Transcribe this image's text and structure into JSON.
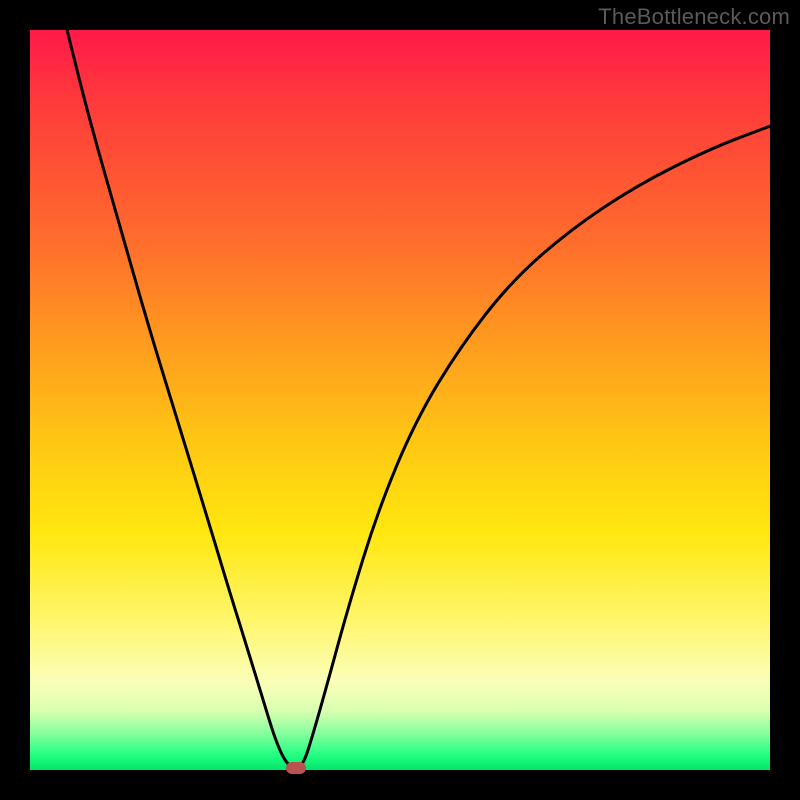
{
  "watermark": "TheBottleneck.com",
  "colors": {
    "frame": "#000000",
    "gradient_top": "#ff1a49",
    "gradient_mid": "#ffe70f",
    "gradient_bottom": "#00e56a",
    "curve": "#000000",
    "marker": "#b9524f"
  },
  "chart_data": {
    "type": "line",
    "title": "",
    "xlabel": "",
    "ylabel": "",
    "xlim": [
      0,
      100
    ],
    "ylim": [
      0,
      100
    ],
    "grid": false,
    "series": [
      {
        "name": "bottleneck-curve",
        "x": [
          5,
          8,
          12,
          16,
          20,
          24,
          27,
          29.5,
          31.5,
          33,
          34.5,
          36,
          37,
          38,
          40,
          43,
          47,
          52,
          58,
          65,
          73,
          82,
          92,
          100
        ],
        "y": [
          100,
          88,
          74,
          60,
          47,
          34,
          24,
          16,
          9.5,
          4.5,
          1,
          0,
          1,
          4,
          11,
          22,
          35,
          47,
          57,
          66,
          73,
          79,
          84,
          87
        ]
      }
    ],
    "annotations": [
      {
        "name": "min-marker",
        "x": 36,
        "y": 0
      }
    ]
  }
}
